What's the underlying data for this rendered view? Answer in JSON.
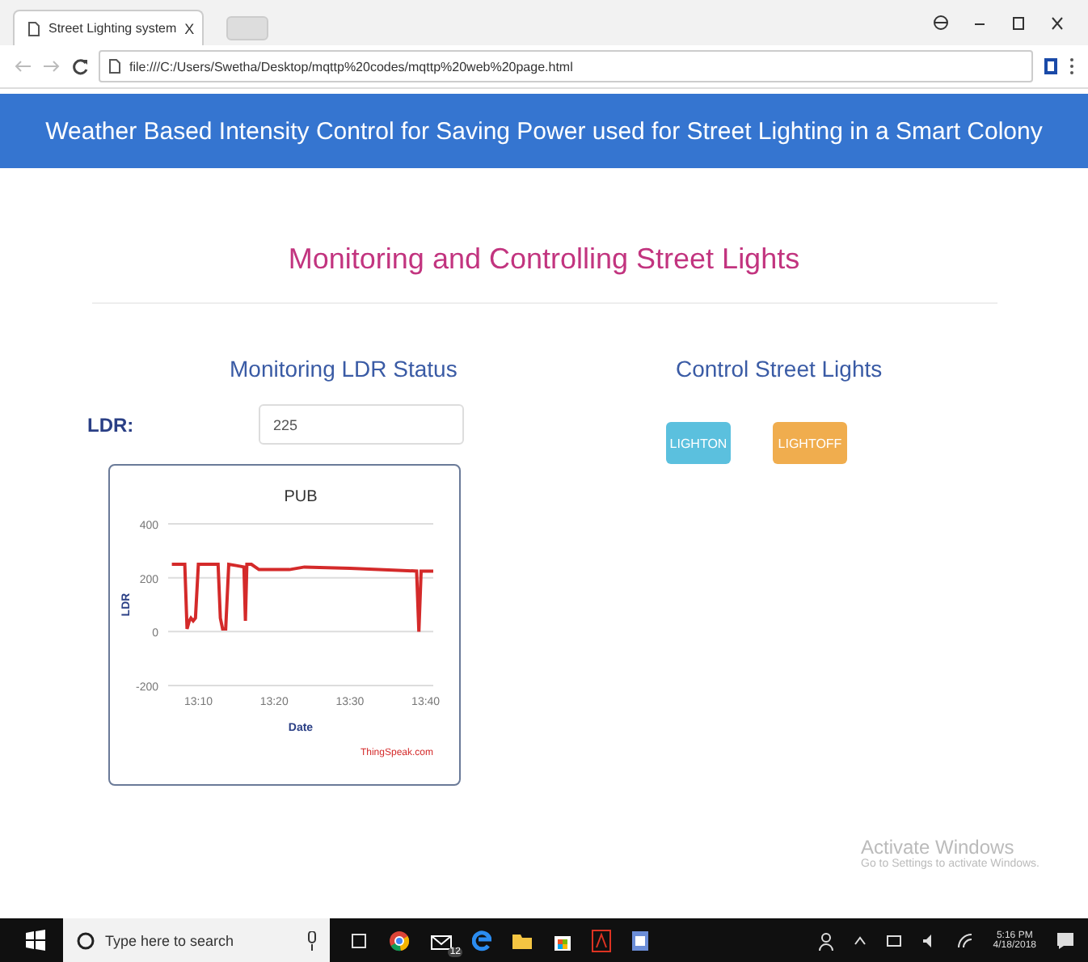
{
  "browser": {
    "tab_title": "Street Lighting system",
    "tab_close": "X",
    "address": "file:///C:/Users/Swetha/Desktop/mqttp%20codes/mqttp%20web%20page.html"
  },
  "header": {
    "title": "Weather Based Intensity Control for Saving Power used for Street Lighting in a Smart Colony"
  },
  "page_title": "Monitoring and Controlling Street Lights",
  "monitor": {
    "heading": "Monitoring LDR Status",
    "ldr_label": "LDR:",
    "ldr_value": "225",
    "chart": {
      "credit": "ThingSpeak.com",
      "chart_data": {
        "type": "line",
        "title": "PUB",
        "xlabel": "Date",
        "ylabel": "LDR",
        "x": [
          786.5,
          787.5,
          788.2,
          788.5,
          788.8,
          789,
          789.3,
          789.6,
          790,
          791,
          792.6,
          792.9,
          793.2,
          793.6,
          794,
          795,
          796,
          796.2,
          796.4,
          797,
          798,
          800,
          802,
          804,
          810,
          818.8,
          819.1,
          819.4,
          820,
          821
        ],
        "series": [
          {
            "color": "#d42a2a",
            "values": [
              250,
              250,
              250,
              10,
              40,
              50,
              40,
              50,
              250,
              250,
              250,
              50,
              10,
              10,
              250,
              245,
              240,
              40,
              250,
              250,
              230,
              230,
              230,
              240,
              235,
              225,
              0,
              225,
              225,
              225
            ]
          }
        ],
        "xlim": [
          786,
          821
        ],
        "ylim": [
          -200,
          400
        ],
        "xticks": [
          {
            "value": 790,
            "label": "13:10"
          },
          {
            "value": 800,
            "label": "13:20"
          },
          {
            "value": 810,
            "label": "13:30"
          },
          {
            "value": 820,
            "label": "13:40"
          }
        ],
        "yticks": [
          -200,
          0,
          200,
          400
        ]
      }
    }
  },
  "control": {
    "heading": "Control Street Lights",
    "buttons": [
      {
        "label": "LIGHTON",
        "kind": "on"
      },
      {
        "label": "LIGHTOFF",
        "kind": "off"
      }
    ]
  },
  "activation": {
    "title": "Activate Windows",
    "subtitle": "Go to Settings to activate Windows."
  },
  "taskbar": {
    "search_placeholder": "Type here to search",
    "mail_badge": "12",
    "time": "5:16 PM",
    "date": "4/18/2018"
  }
}
